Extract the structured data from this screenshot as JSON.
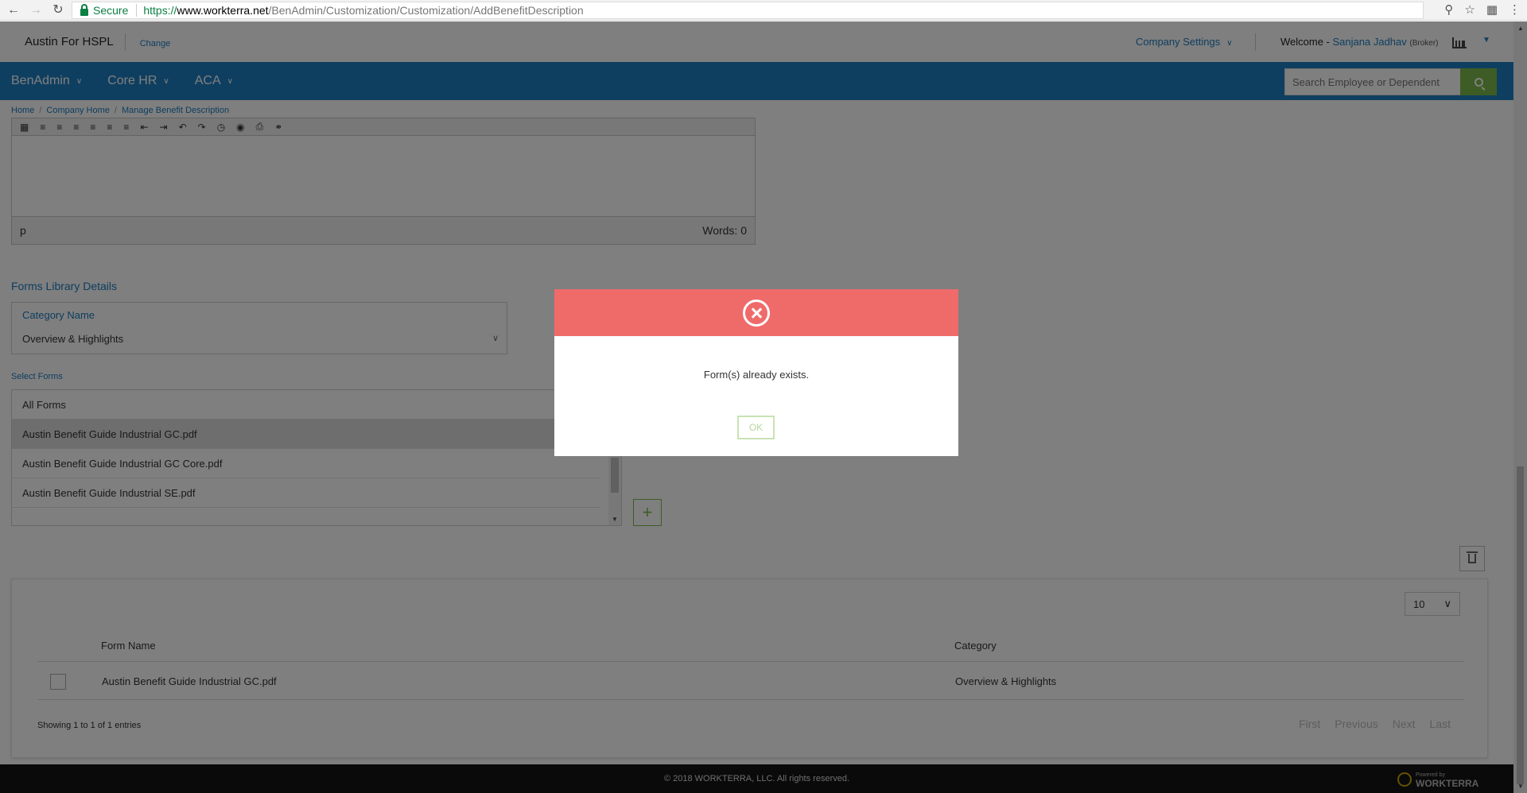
{
  "browser": {
    "secure_label": "Secure",
    "url_scheme": "https://",
    "url_host": "www.workterra.net",
    "url_path": "/BenAdmin/Customization/Customization/AddBenefitDescription"
  },
  "header": {
    "company": "Austin For HSPL",
    "change": "Change",
    "company_settings": "Company Settings",
    "welcome_prefix": "Welcome -",
    "user_name": "Sanjana Jadhav",
    "user_role": "(Broker)"
  },
  "nav": {
    "items": [
      "BenAdmin",
      "Core HR",
      "ACA"
    ],
    "search_placeholder": "Search Employee or Dependent"
  },
  "breadcrumb": [
    "Home",
    "Company Home",
    "Manage Benefit Description"
  ],
  "editor": {
    "path": "p",
    "word_count": "Words: 0"
  },
  "forms_library": {
    "title": "Forms Library Details",
    "category_label": "Category Name",
    "category_value": "Overview & Highlights",
    "select_forms_label": "Select Forms",
    "forms": [
      "All Forms",
      "Austin Benefit Guide Industrial GC.pdf",
      "Austin Benefit Guide Industrial GC Core.pdf",
      "Austin Benefit Guide Industrial SE.pdf"
    ],
    "add_label": "+"
  },
  "table": {
    "page_size": "10",
    "columns": [
      "Form Name",
      "Category"
    ],
    "rows": [
      {
        "form_name": "Austin Benefit Guide Industrial GC.pdf",
        "category": "Overview & Highlights"
      }
    ],
    "showing": "Showing 1 to 1 of 1 entries",
    "pager": [
      "First",
      "Previous",
      "Next",
      "Last"
    ]
  },
  "footer": {
    "copyright": "© 2018 WORKTERRA, LLC. All rights reserved.",
    "powered_by": "Powered by",
    "brand": "WORKTERRA"
  },
  "modal": {
    "message": "Form(s) already exists.",
    "ok_label": "OK"
  },
  "colors": {
    "nav_blue": "#1e7fc1",
    "accent_green": "#7cb94a",
    "modal_error": "#ef6b6a"
  }
}
